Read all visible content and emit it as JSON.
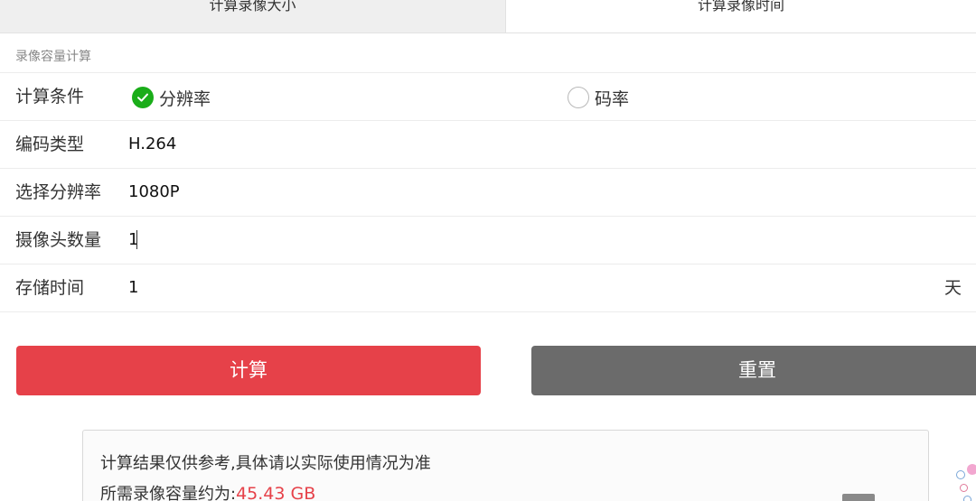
{
  "tabs": [
    {
      "label": "计算录像大小",
      "active": false
    },
    {
      "label": "计算录像时间",
      "active": true
    }
  ],
  "section": {
    "title": "录像容量计算"
  },
  "form": {
    "condition": {
      "label": "计算条件",
      "options": [
        {
          "label": "分辨率",
          "checked": true
        },
        {
          "label": "码率",
          "checked": false
        }
      ]
    },
    "encoding": {
      "label": "编码类型",
      "value": "H.264"
    },
    "resolution": {
      "label": "选择分辨率",
      "value": "1080P"
    },
    "cameras": {
      "label": "摄像头数量",
      "value": "1"
    },
    "storage": {
      "label": "存储时间",
      "value": "1",
      "unit": "天"
    }
  },
  "buttons": {
    "calculate": "计算",
    "reset": "重置"
  },
  "result": {
    "note": "计算结果仅供参考,具体请以实际使用情况为准",
    "prefix": "所需录像容量约为:",
    "value": "45.43 GB"
  },
  "colors": {
    "accent_red": "#e64149",
    "reset_gray": "#6b6b6b",
    "check_green": "#1aad19"
  }
}
